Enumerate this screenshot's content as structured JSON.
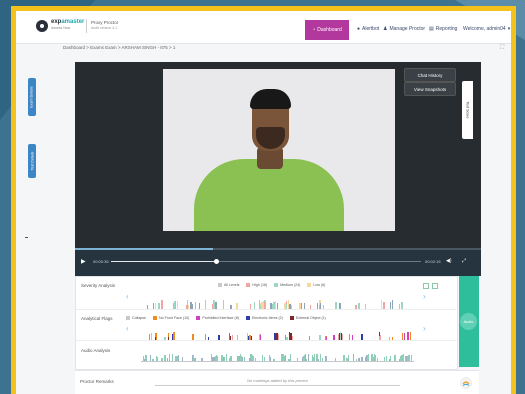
{
  "topbar": {
    "logo_prefix": "exp",
    "logo_accent": "amaster",
    "logo_sub": "Assess Now",
    "product_title": "Proxy Proctor",
    "product_sub": "Audit version 4.1",
    "nav": [
      {
        "label": "Dashboard",
        "icon": "gauge-icon"
      },
      {
        "label": "Alertbot",
        "icon": "bot-icon"
      },
      {
        "label": "Manage Proctor",
        "icon": "user-icon"
      },
      {
        "label": "Reporting",
        "icon": "report-icon"
      },
      {
        "label": "Welcome, admin04",
        "icon": "chevron-down-icon"
      }
    ]
  },
  "breadcrumb": "Dashboard > Exams Exam > ARSHAM SINGH - 875 > 1",
  "side_tabs": [
    "Exam Details",
    "Test Details"
  ],
  "video": {
    "chat_history": "Chat History",
    "view_snapshots": "View Snapshots",
    "test_score_tab": "Test Score",
    "current_time": "00:00:35",
    "duration": "00:02:15",
    "progress": 0.34
  },
  "severity": {
    "label": "Severity Analysis",
    "legend": [
      {
        "name": "All Levels",
        "color": "#c9c9c9"
      },
      {
        "name": "High (18)",
        "color": "#f2a4a4"
      },
      {
        "name": "Medium (24)",
        "color": "#9ed8c2"
      },
      {
        "name": "Low (6)",
        "color": "#f7d79c"
      }
    ]
  },
  "flags": {
    "label": "Analytical Flags",
    "legend": [
      {
        "name": "Collapse",
        "color": "#c9c9c9"
      },
      {
        "name": "No Front Face (10)",
        "color": "#f08a24"
      },
      {
        "name": "Prohibited Interface (8)",
        "color": "#d23fbf"
      },
      {
        "name": "Electronic Items (2)",
        "color": "#2d3ea8"
      },
      {
        "name": "External Object (1)",
        "color": "#7a2a2a"
      }
    ]
  },
  "audio": {
    "label": "Audio Analysis",
    "button_label": "Audio"
  },
  "proctor": {
    "label": "Proctor Remarks",
    "empty_text": "No markings added by this proctor"
  },
  "colors": {
    "accent": "#b3389e",
    "frame": "#f4c21a",
    "audio": "#2fbe9b",
    "side_tab": "#3d86c6"
  }
}
